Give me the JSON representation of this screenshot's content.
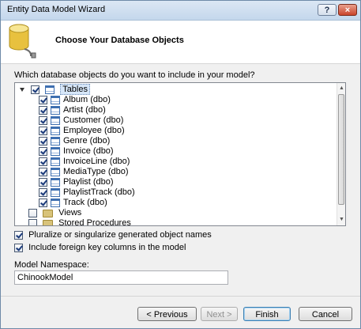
{
  "window": {
    "title": "Entity Data Model Wizard",
    "help_label": "?",
    "close_label": "×"
  },
  "header": {
    "title": "Choose Your Database Objects",
    "icon": "database-icon"
  },
  "prompt": "Which database objects do you want to include in your model?",
  "tree": {
    "root": {
      "label": "Tables",
      "checked": true,
      "expanded": true
    },
    "tables": [
      "Album (dbo)",
      "Artist (dbo)",
      "Customer (dbo)",
      "Employee (dbo)",
      "Genre (dbo)",
      "Invoice (dbo)",
      "InvoiceLine (dbo)",
      "MediaType (dbo)",
      "Playlist (dbo)",
      "PlaylistTrack (dbo)",
      "Track (dbo)"
    ],
    "views": {
      "label": "Views",
      "checked": false
    },
    "stored_procedures": {
      "label": "Stored Procedures",
      "checked": false
    }
  },
  "options": {
    "pluralize": {
      "label": "Pluralize or singularize generated object names",
      "checked": true
    },
    "foreign_keys": {
      "label": "Include foreign key columns in the model",
      "checked": true
    }
  },
  "namespace": {
    "label": "Model Namespace:",
    "value": "ChinookModel"
  },
  "buttons": {
    "previous": "< Previous",
    "next": "Next >",
    "finish": "Finish",
    "cancel": "Cancel"
  },
  "colors": {
    "accent": "#3c7fb1",
    "selection": "#d6e6f8"
  }
}
